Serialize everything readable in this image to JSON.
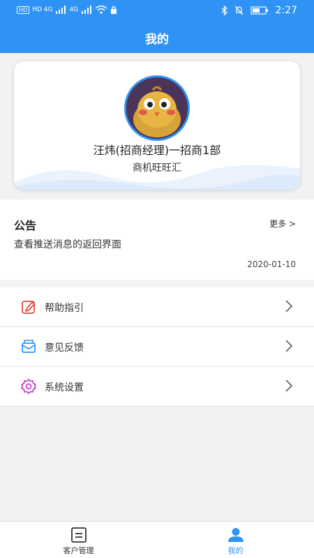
{
  "status_bar": {
    "network_left": "HD 4G",
    "network_right": "4G",
    "time": "2:27"
  },
  "app_bar": {
    "title": "我的"
  },
  "profile": {
    "name": "汪炜(招商经理)一招商1部",
    "company": "商机旺旺汇"
  },
  "notice": {
    "title": "公告",
    "more": "更多 >",
    "body": "查看推送消息的返回界面",
    "date": "2020-01-10"
  },
  "menu": {
    "items": [
      {
        "label": "帮助指引",
        "icon": "edit-icon",
        "color": "#e64a3b"
      },
      {
        "label": "意见反馈",
        "icon": "mail-icon",
        "color": "#2f93f5"
      },
      {
        "label": "系统设置",
        "icon": "gear-icon",
        "color": "#c431c9"
      }
    ]
  },
  "tabs": [
    {
      "label": "客户管理",
      "icon": "list-icon",
      "active": false
    },
    {
      "label": "我的",
      "icon": "person-icon",
      "active": true
    }
  ],
  "colors": {
    "primary": "#2f93f5",
    "background": "#f2f2f2"
  }
}
